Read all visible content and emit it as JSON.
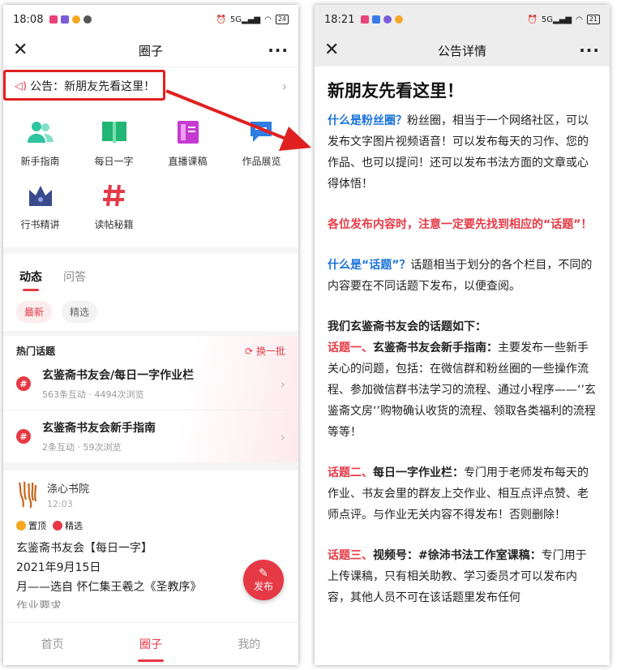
{
  "left": {
    "status": {
      "time": "18:08",
      "battery": "24"
    },
    "nav_title": "圈子",
    "announcement": "公告：新朋友先看这里！",
    "shortcuts": [
      {
        "label": "新手指南",
        "icon": "users-icon",
        "color": "#2ec4a0"
      },
      {
        "label": "每日一字",
        "icon": "book-icon",
        "color": "#22b573"
      },
      {
        "label": "直播课稿",
        "icon": "notebook-icon",
        "color": "#c43ad1"
      },
      {
        "label": "作品展览",
        "icon": "chat-icon",
        "color": "#2f7de1"
      },
      {
        "label": "行书精讲",
        "icon": "crown-icon",
        "color": "#3b4a8c"
      },
      {
        "label": "读帖秘籍",
        "icon": "hashtag-icon",
        "color": "#e53945"
      }
    ],
    "tabs": [
      "动态",
      "问答"
    ],
    "filters": [
      "最新",
      "精选"
    ],
    "hot": {
      "title": "热门话题",
      "refresh": "换一批",
      "topics": [
        {
          "title": "玄鉴斋书友会/每日一字作业栏",
          "stats": "563条互动 · 4494次浏览"
        },
        {
          "title": "玄鉴斋书友会新手指南",
          "stats": "2条互动 · 59次浏览"
        }
      ]
    },
    "post": {
      "author": "涤心书院",
      "time": "12:03",
      "badges": [
        "置顶",
        "精选"
      ],
      "lines": [
        "玄鉴斋书友会【每日一字】",
        "2021年9月15日",
        "月——选自 怀仁集王羲之《圣教序》",
        "作业要求..."
      ]
    },
    "fab": "发布",
    "bottom_nav": [
      "首页",
      "圈子",
      "我的"
    ]
  },
  "right": {
    "status": {
      "time": "18:21",
      "battery": "21"
    },
    "nav_title": "公告详情",
    "title": "新朋友先看这里！",
    "p1": {
      "q": "什么是粉丝圈？",
      "text": "粉丝圈，相当于一个网络社区，可以发布文字图片视频语音！可以发布每天的习作、您的作品、也可以提问！还可以发布书法方面的文章或心得体悟！"
    },
    "p2": "各位发布内容时，注意一定要先找到相应的“话题”！",
    "p3": {
      "q": "什么是“话题”？",
      "text": "话题相当于划分的各个栏目，不同的内容要在不同话题下发布，以便查阅。"
    },
    "p4": {
      "head": "我们玄鉴斋书友会的话题如下：",
      "t1_label": "话题一、",
      "t1_name": "玄鉴斋书友会新手指南：",
      "t1_text": "主要发布一些新手关心的问题，包括：在微信群和粉丝圈的一些操作流程、参加微信群书法学习的流程、通过小程序——‘’玄鉴斋文房‘’购物确认收货的流程、领取各类福利的流程等等！"
    },
    "p5": {
      "label": "话题二、",
      "name": "每日一字作业栏：",
      "text": "专门用于老师发布每天的作业、书友会里的群友上交作业、相互点评点赞、老师点评。与作业无关内容不得发布！否则删除！"
    },
    "p6": {
      "label": "话题三、",
      "name": "视频号：#徐沛书法工作室课稿：",
      "text": "专门用于上传课稿，只有相关助教、学习委员才可以发布内容，其他人员不可在该话题里发布任何"
    }
  }
}
